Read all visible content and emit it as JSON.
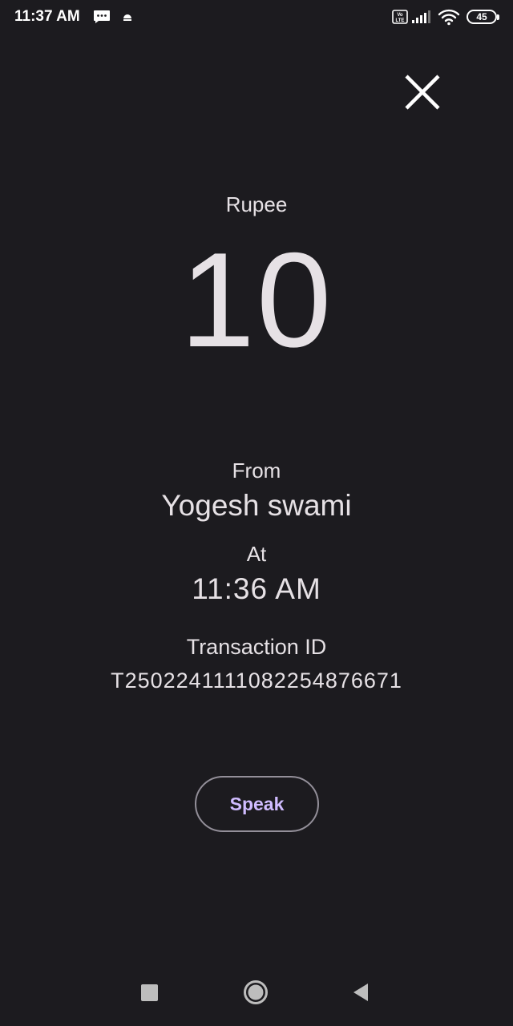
{
  "status_bar": {
    "time": "11:37 AM",
    "battery": "45",
    "icons": [
      "message-icon",
      "notification-dot-icon",
      "volte-icon",
      "signal-icon",
      "wifi-icon",
      "battery-icon"
    ]
  },
  "close": {
    "icon": "close-icon"
  },
  "payment": {
    "currency": "Rupee",
    "amount": "10",
    "from_label": "From",
    "sender": "Yogesh swami",
    "at_label": "At",
    "time": "11:36 AM",
    "transaction_label": "Transaction ID",
    "transaction_id": "T2502241111082254876671"
  },
  "actions": {
    "speak_label": "Speak"
  },
  "nav_bar": {
    "icons": [
      "recents-icon",
      "home-icon",
      "back-icon"
    ]
  },
  "colors": {
    "background": "#1c1b1f",
    "text": "#e6e1e5",
    "button_text": "#d0bcff",
    "button_border": "#938f99"
  }
}
